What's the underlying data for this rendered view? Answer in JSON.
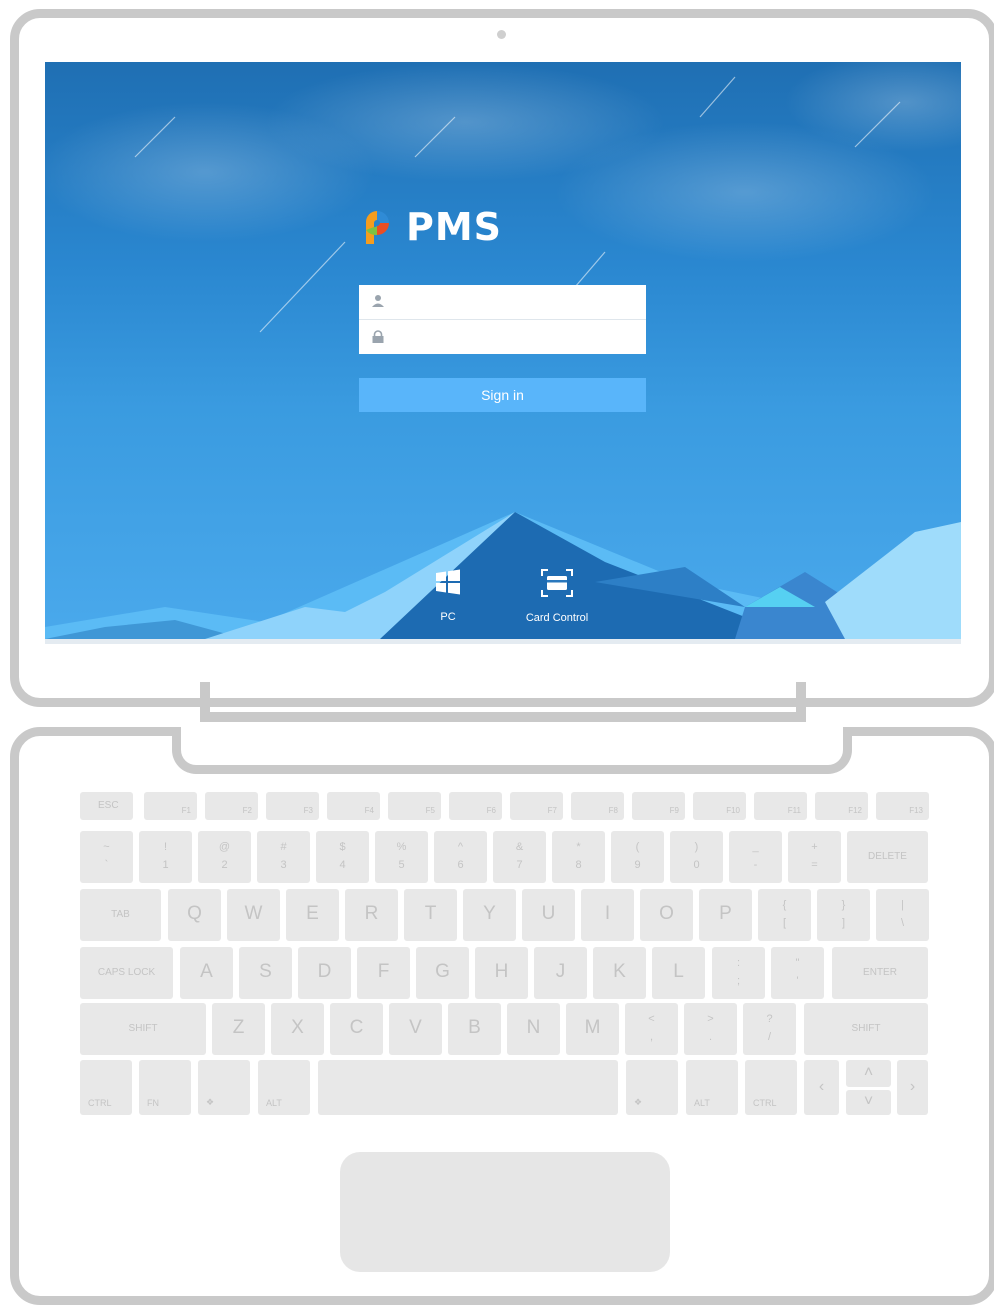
{
  "app": {
    "name": "PMS"
  },
  "login": {
    "username_placeholder": "",
    "password_placeholder": "",
    "signin_label": "Sign in"
  },
  "bottom_options": [
    {
      "label": "PC",
      "icon": "windows-icon"
    },
    {
      "label": "Card Control",
      "icon": "card-scan-icon"
    }
  ],
  "keyboard": {
    "fn_row": [
      "ESC",
      "F1",
      "F2",
      "F3",
      "F4",
      "F5",
      "F6",
      "F7",
      "F8",
      "F9",
      "F10",
      "F11",
      "F12",
      "F13"
    ],
    "num_row": [
      [
        "~",
        "`"
      ],
      [
        "!",
        "1"
      ],
      [
        "@",
        "2"
      ],
      [
        "#",
        "3"
      ],
      [
        "$",
        "4"
      ],
      [
        "%",
        "5"
      ],
      [
        "^",
        "6"
      ],
      [
        "&",
        "7"
      ],
      [
        "*",
        "8"
      ],
      [
        "(",
        "9"
      ],
      [
        ")",
        "0"
      ],
      [
        "_",
        "-"
      ],
      [
        "+",
        "="
      ]
    ],
    "delete": "DELETE",
    "tab": "TAB",
    "q_row": [
      "Q",
      "W",
      "E",
      "R",
      "T",
      "Y",
      "U",
      "I",
      "O",
      "P"
    ],
    "q_row_extra": [
      [
        "{",
        "["
      ],
      [
        "}",
        "]"
      ],
      [
        "|",
        "\\"
      ]
    ],
    "caps": "CAPS LOCK",
    "a_row": [
      "A",
      "S",
      "D",
      "F",
      "G",
      "H",
      "J",
      "K",
      "L"
    ],
    "a_row_extra": [
      [
        ":",
        ";"
      ],
      [
        "\"",
        "'"
      ]
    ],
    "enter": "ENTER",
    "shift": "SHIFT",
    "z_row": [
      "Z",
      "X",
      "C",
      "V",
      "B",
      "N",
      "M"
    ],
    "z_row_extra": [
      [
        "<",
        ","
      ],
      [
        ">",
        "."
      ],
      [
        "?",
        "/"
      ]
    ],
    "ctrl": "CTRL",
    "fn": "FN",
    "alt": "ALT"
  },
  "colors": {
    "accent": "#59b5fa",
    "frame": "#c9c9c9",
    "key": "#e8e8e8"
  }
}
